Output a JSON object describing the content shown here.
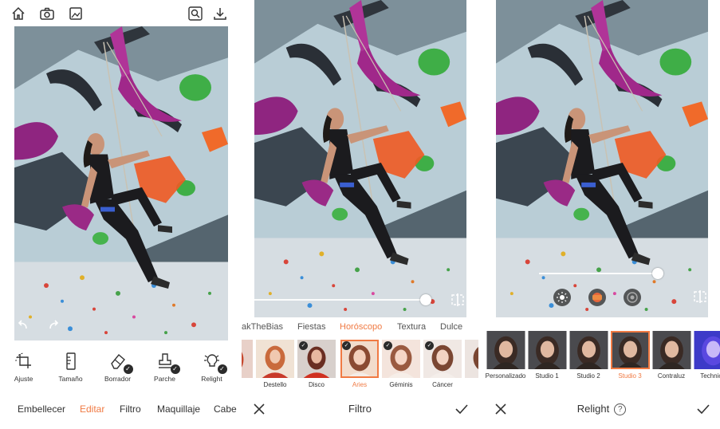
{
  "panel_editor": {
    "tools": [
      {
        "icon": "crop-rotate-icon",
        "label": "Ajuste",
        "badge": false
      },
      {
        "icon": "ruler-icon",
        "label": "Tamaño",
        "badge": false
      },
      {
        "icon": "eraser-icon",
        "label": "Borrador",
        "badge": true
      },
      {
        "icon": "stamp-icon",
        "label": "Parche",
        "badge": true
      },
      {
        "icon": "relight-bulb-icon",
        "label": "Relight",
        "badge": true
      }
    ],
    "nav": [
      "Embellecer",
      "Editar",
      "Filtro",
      "Maquillaje",
      "Cabe"
    ],
    "nav_active": "Editar"
  },
  "panel_filter": {
    "categories": [
      "akTheBias",
      "Fiestas",
      "Horóscopo",
      "Textura",
      "Dulce"
    ],
    "category_active": "Horóscopo",
    "thumbnails": [
      "Destello",
      "Disco",
      "Aries",
      "Géminis",
      "Cáncer"
    ],
    "thumbnail_active": "Aries",
    "title": "Filtro",
    "slider_value": 1.0
  },
  "panel_relight": {
    "presets": [
      "Personalizado",
      "Studio 1",
      "Studio 2",
      "Studio 3",
      "Contraluz",
      "Technico"
    ],
    "preset_active": "Studio 3",
    "title": "Relight",
    "help_glyph": "?",
    "slider_value": 1.0
  },
  "colors": {
    "accent": "#f07a43",
    "magenta_hold": "#a0288a",
    "green_hold": "#3fae47",
    "orange_hold": "#f05a22",
    "wall": "#bcd0d8"
  }
}
